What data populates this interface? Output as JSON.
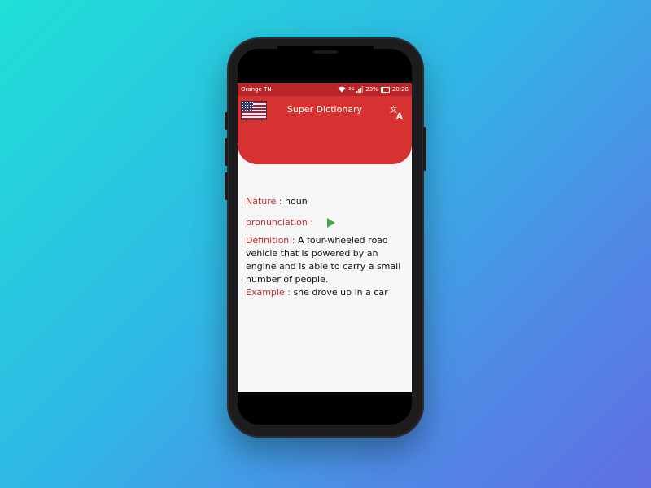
{
  "statusbar": {
    "carrier": "Orange TN",
    "signal": "3G",
    "battery": "23%",
    "time": "20:28"
  },
  "appbar": {
    "title": "Super Dictionary",
    "flag_icon": "us-flag-icon",
    "action_icon": "translate-icon"
  },
  "entry": {
    "nature_label": "Nature :",
    "nature_value": "noun",
    "pronunciation_label": "pronunciation :",
    "definition_label": "Definition :",
    "definition_value": "A four-wheeled road vehicle that is powered by an engine and is able to carry a small number of people.",
    "example_label": "Example :",
    "example_value": "she drove up in a car"
  },
  "colors": {
    "primary": "#d63232",
    "status_bar": "#b8262a",
    "label": "#c62828",
    "play": "#3fa945"
  }
}
